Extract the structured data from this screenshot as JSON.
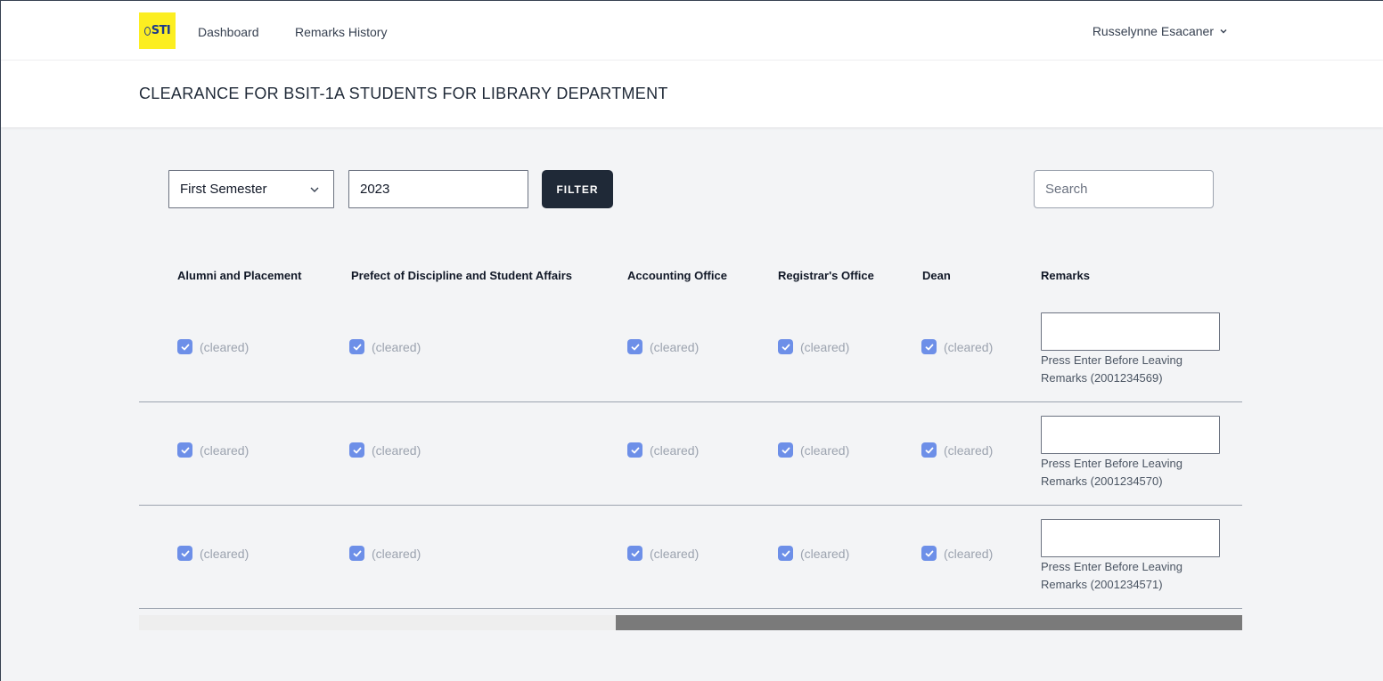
{
  "nav": {
    "logo_text": "STI",
    "links": [
      "Dashboard",
      "Remarks History"
    ],
    "user_name": "Russelynne Esacaner"
  },
  "header": {
    "title": "CLEARANCE FOR BSIT-1A STUDENTS FOR LIBRARY DEPARTMENT"
  },
  "filters": {
    "semester_selected": "First Semester",
    "year_value": "2023",
    "filter_label": "FILTER",
    "search_placeholder": "Search"
  },
  "table": {
    "columns": [
      "Alumni and Placement",
      "Prefect of Discipline and Student Affairs",
      "Accounting Office",
      "Registrar's Office",
      "Dean",
      "Remarks"
    ],
    "status_label": "(cleared)",
    "rows": [
      {
        "hint_line1": "Press Enter Before Leaving",
        "hint_line2": "Remarks (2001234569)"
      },
      {
        "hint_line1": "Press Enter Before Leaving",
        "hint_line2": "Remarks (2001234570)"
      },
      {
        "hint_line1": "Press Enter Before Leaving",
        "hint_line2": "Remarks (2001234571)"
      }
    ]
  },
  "colors": {
    "accent_dark": "#1f2937",
    "checkbox": "#6d8fe8",
    "logo_bg": "#fcee21"
  }
}
